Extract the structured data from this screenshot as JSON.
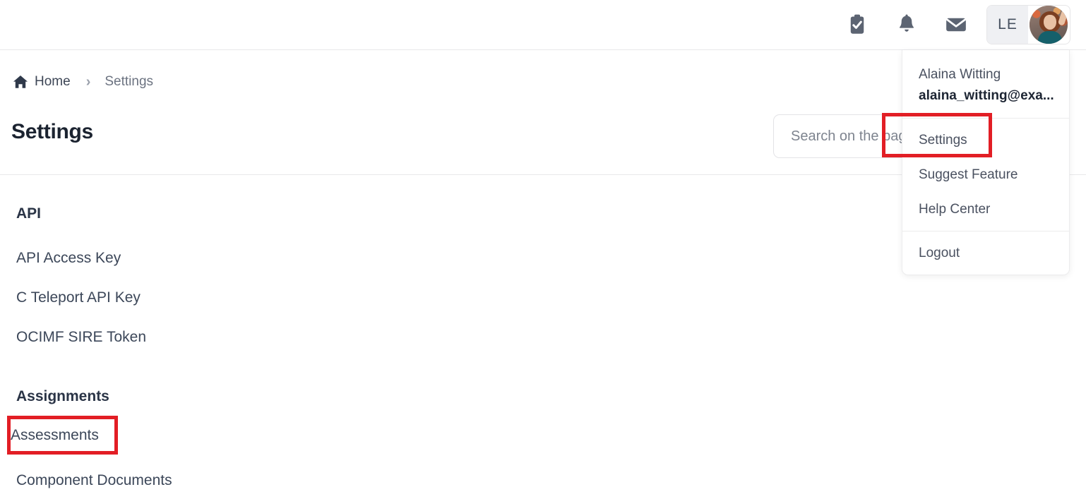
{
  "topbar": {
    "icons": [
      {
        "name": "clipboard-check-icon",
        "label": "Tasks"
      },
      {
        "name": "bell-icon",
        "label": "Notifications"
      },
      {
        "name": "envelope-icon",
        "label": "Messages"
      }
    ],
    "user_chip": {
      "initials": "LE",
      "avatar_name": "user-avatar-photo"
    },
    "icon_color": "#5c6472"
  },
  "breadcrumb": {
    "home_label": "Home",
    "separator": "›",
    "current_label": "Settings"
  },
  "page": {
    "title": "Settings"
  },
  "search": {
    "placeholder": "Search on the page",
    "value": ""
  },
  "dropdown": {
    "user_name": "Alaina Witting",
    "user_email": "alaina_witting@exa...",
    "items": [
      {
        "label": "Settings",
        "highlighted": true
      },
      {
        "label": "Suggest Feature",
        "highlighted": false
      },
      {
        "label": "Help Center",
        "highlighted": false
      }
    ],
    "logout_label": "Logout"
  },
  "content": {
    "groups": [
      {
        "title": "API",
        "links": [
          "API Access Key",
          "C Teleport API Key",
          "OCIMF SIRE Token"
        ]
      },
      {
        "title": "Assignments",
        "links": [
          "Assessments",
          "Component Documents"
        ]
      }
    ]
  },
  "highlights": {
    "accent_color": "#e21e25",
    "settings_menu_item": "Settings",
    "assessments_link": "Assessments"
  }
}
